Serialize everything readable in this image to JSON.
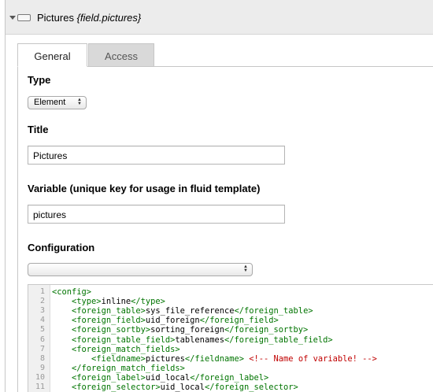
{
  "header": {
    "title": "Pictures",
    "field_key": "{field.pictures}"
  },
  "tabs": [
    {
      "label": "General",
      "active": true
    },
    {
      "label": "Access",
      "active": false
    }
  ],
  "form": {
    "type_label": "Type",
    "type_value": "Element",
    "title_label": "Title",
    "title_value": "Pictures",
    "variable_label": "Variable (unique key for usage in fluid template)",
    "variable_value": "pictures",
    "configuration_label": "Configuration",
    "configuration_value": ""
  },
  "editor": {
    "lines": [
      {
        "no": "1",
        "indent": "",
        "parts": [
          {
            "t": "tag",
            "v": "<config>"
          }
        ]
      },
      {
        "no": "2",
        "indent": "    ",
        "parts": [
          {
            "t": "tag",
            "v": "<type>"
          },
          {
            "t": "txt",
            "v": "inline"
          },
          {
            "t": "tag",
            "v": "</type>"
          }
        ]
      },
      {
        "no": "3",
        "indent": "    ",
        "parts": [
          {
            "t": "tag",
            "v": "<foreign_table>"
          },
          {
            "t": "txt",
            "v": "sys_file_reference"
          },
          {
            "t": "tag",
            "v": "</foreign_table>"
          }
        ]
      },
      {
        "no": "4",
        "indent": "    ",
        "parts": [
          {
            "t": "tag",
            "v": "<foreign_field>"
          },
          {
            "t": "txt",
            "v": "uid_foreign"
          },
          {
            "t": "tag",
            "v": "</foreign_field>"
          }
        ]
      },
      {
        "no": "5",
        "indent": "    ",
        "parts": [
          {
            "t": "tag",
            "v": "<foreign_sortby>"
          },
          {
            "t": "txt",
            "v": "sorting_foreign"
          },
          {
            "t": "tag",
            "v": "</foreign_sortby>"
          }
        ]
      },
      {
        "no": "6",
        "indent": "    ",
        "parts": [
          {
            "t": "tag",
            "v": "<foreign_table_field>"
          },
          {
            "t": "txt",
            "v": "tablenames"
          },
          {
            "t": "tag",
            "v": "</foreign_table_field>"
          }
        ]
      },
      {
        "no": "7",
        "indent": "    ",
        "parts": [
          {
            "t": "tag",
            "v": "<foreign_match_fields>"
          }
        ]
      },
      {
        "no": "8",
        "indent": "        ",
        "parts": [
          {
            "t": "tag",
            "v": "<fieldname>"
          },
          {
            "t": "txt",
            "v": "pictures"
          },
          {
            "t": "tag",
            "v": "</fieldname>"
          },
          {
            "t": "txt",
            "v": " "
          },
          {
            "t": "cmt",
            "v": "<!-- Name of variable! -->"
          }
        ]
      },
      {
        "no": "9",
        "indent": "    ",
        "parts": [
          {
            "t": "tag",
            "v": "</foreign_match_fields>"
          }
        ]
      },
      {
        "no": "10",
        "indent": "    ",
        "parts": [
          {
            "t": "tag",
            "v": "<foreign_label>"
          },
          {
            "t": "txt",
            "v": "uid_local"
          },
          {
            "t": "tag",
            "v": "</foreign_label>"
          }
        ]
      },
      {
        "no": "11",
        "indent": "    ",
        "parts": [
          {
            "t": "tag",
            "v": "<foreign_selector>"
          },
          {
            "t": "txt",
            "v": "uid_local"
          },
          {
            "t": "tag",
            "v": "</foreign_selector>"
          }
        ]
      }
    ]
  }
}
